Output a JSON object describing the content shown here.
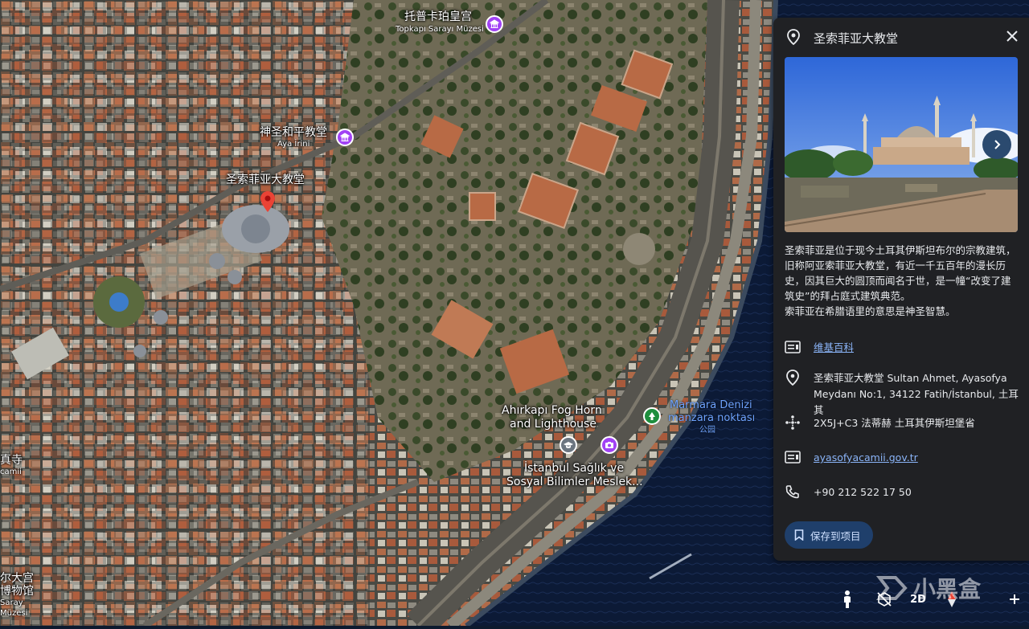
{
  "map": {
    "labels": {
      "topkapi_cn": "托普卡珀皇宫",
      "topkapi_local": "Topkapı Sarayı Müzesi",
      "irene_cn": "神圣和平教堂",
      "irene_local": "Aya İrini",
      "hagia_cn": "圣索菲亚大教堂",
      "ahirkapi": "Ahırkapı Fog Horn",
      "ahirkapi2": "and Lighthouse",
      "istanbul_uni": "İstanbul Sağlık ve",
      "istanbul_uni2": "Sosyal Bilimler Meslek...",
      "marmara1": "Marmara Denizi",
      "marmara2": "manzara noktası",
      "marmara3": "公园",
      "left_mosque1": "真寺",
      "left_mosque2": "camii",
      "left_museum1": "尔大宫",
      "left_museum2": "博物馆",
      "left_museum3": "Saray",
      "left_museum4": "Müzesi"
    }
  },
  "panel": {
    "title": "圣索菲亚大教堂",
    "description_1": "圣索菲亚是位于现今土耳其伊斯坦布尔的宗教建筑，旧称阿亚索菲亚大教堂，有近一千五百年的漫长历史，因其巨大的圆顶而闻名于世，是一幢“改变了建筑史”的拜占庭式建筑典范。",
    "description_2": "索菲亚在希腊语里的意思是神圣智慧。",
    "wiki_link": "维基百科",
    "address": "圣索菲亚大教堂 Sultan Ahmet, Ayasofya Meydanı No:1, 34122 Fatih/İstanbul, 土耳其",
    "plus_code": "2X5J+C3 法蒂赫 土耳其伊斯坦堡省",
    "website": "ayasofyacamii.gov.tr",
    "phone": "+90 212 522 17 50",
    "save_label": "保存到项目"
  },
  "controls": {
    "mode_2d": "2D"
  },
  "watermark": {
    "text": "小黑盒"
  },
  "colors": {
    "panel_bg": "#202124",
    "link": "#8ab4f8",
    "accent": "#1f3f6b",
    "poi_purple": "#a142f4",
    "sea": "#0c1a36"
  }
}
